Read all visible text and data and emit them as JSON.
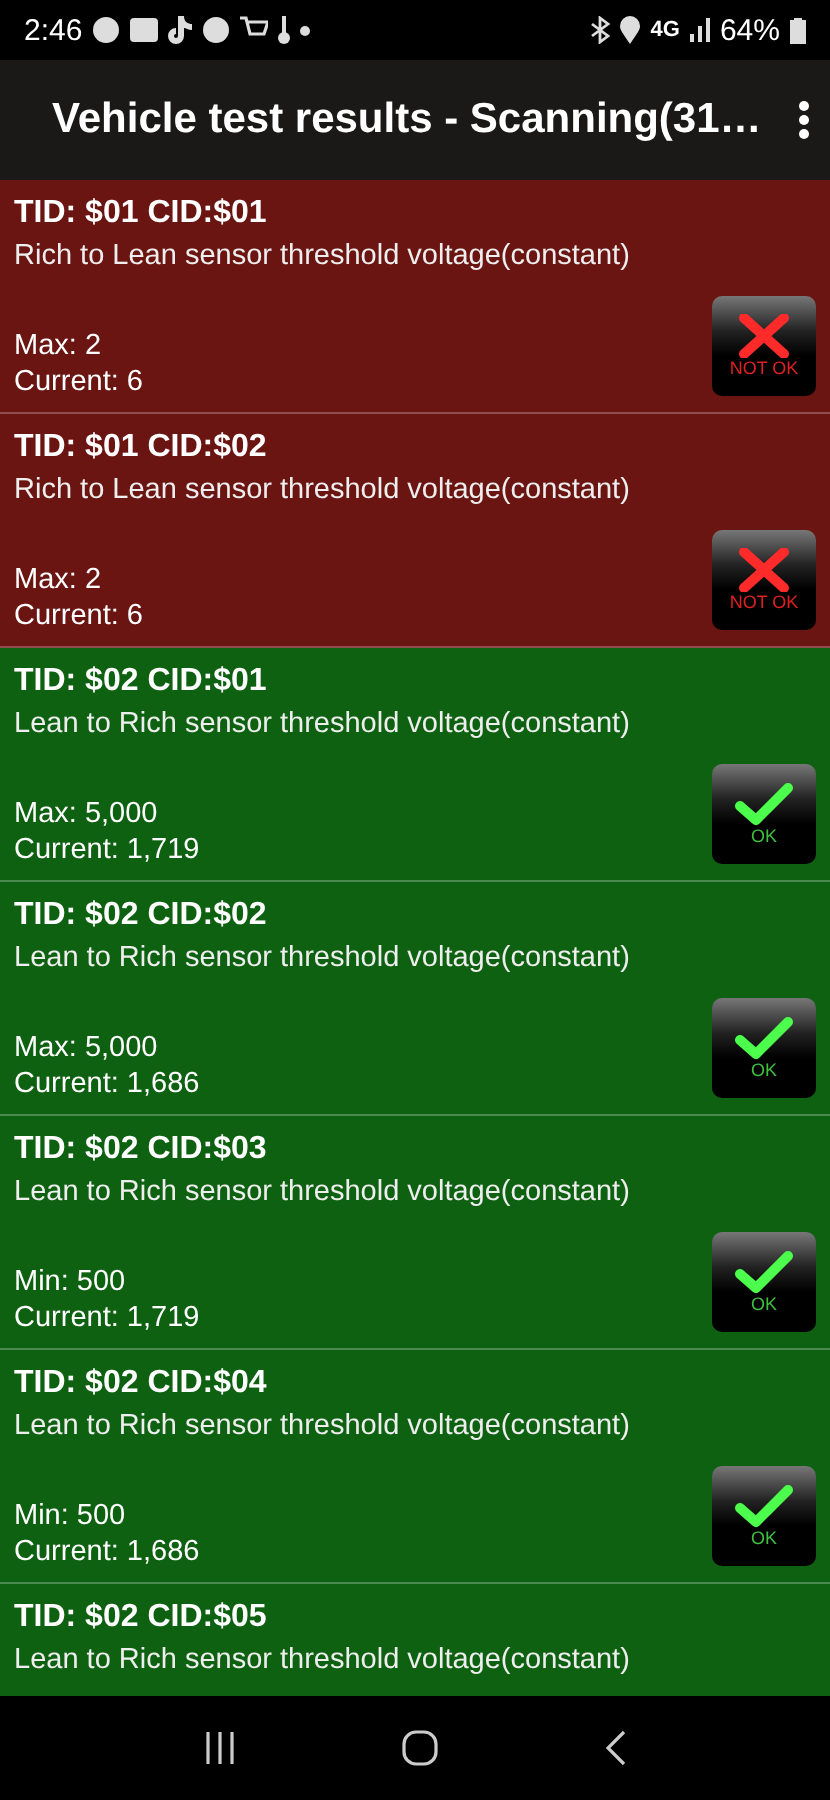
{
  "status_bar": {
    "time": "2:46",
    "network": "4G",
    "battery": "64%"
  },
  "app_bar": {
    "title": "Vehicle test results - Scanning(31…"
  },
  "results": [
    {
      "title": "TID: $01 CID:$01",
      "description": "Rich to Lean sensor threshold voltage(constant)",
      "limit": "Max: 2",
      "current": "Current: 6",
      "kind": "fail",
      "badge": "NOT OK"
    },
    {
      "title": "TID: $01 CID:$02",
      "description": "Rich to Lean sensor threshold voltage(constant)",
      "limit": "Max: 2",
      "current": "Current: 6",
      "kind": "fail",
      "badge": "NOT OK"
    },
    {
      "title": "TID: $02 CID:$01",
      "description": "Lean to Rich sensor threshold voltage(constant)",
      "limit": "Max: 5,000",
      "current": "Current: 1,719",
      "kind": "pass",
      "badge": "OK"
    },
    {
      "title": "TID: $02 CID:$02",
      "description": "Lean to Rich sensor threshold voltage(constant)",
      "limit": "Max: 5,000",
      "current": "Current: 1,686",
      "kind": "pass",
      "badge": "OK"
    },
    {
      "title": "TID: $02 CID:$03",
      "description": "Lean to Rich sensor threshold voltage(constant)",
      "limit": "Min: 500",
      "current": "Current: 1,719",
      "kind": "pass",
      "badge": "OK"
    },
    {
      "title": "TID: $02 CID:$04",
      "description": "Lean to Rich sensor threshold voltage(constant)",
      "limit": "Min: 500",
      "current": "Current: 1,686",
      "kind": "pass",
      "badge": "OK"
    },
    {
      "title": "TID: $02 CID:$05",
      "description": "Lean to Rich sensor threshold voltage(constant)",
      "kind": "pass"
    }
  ]
}
